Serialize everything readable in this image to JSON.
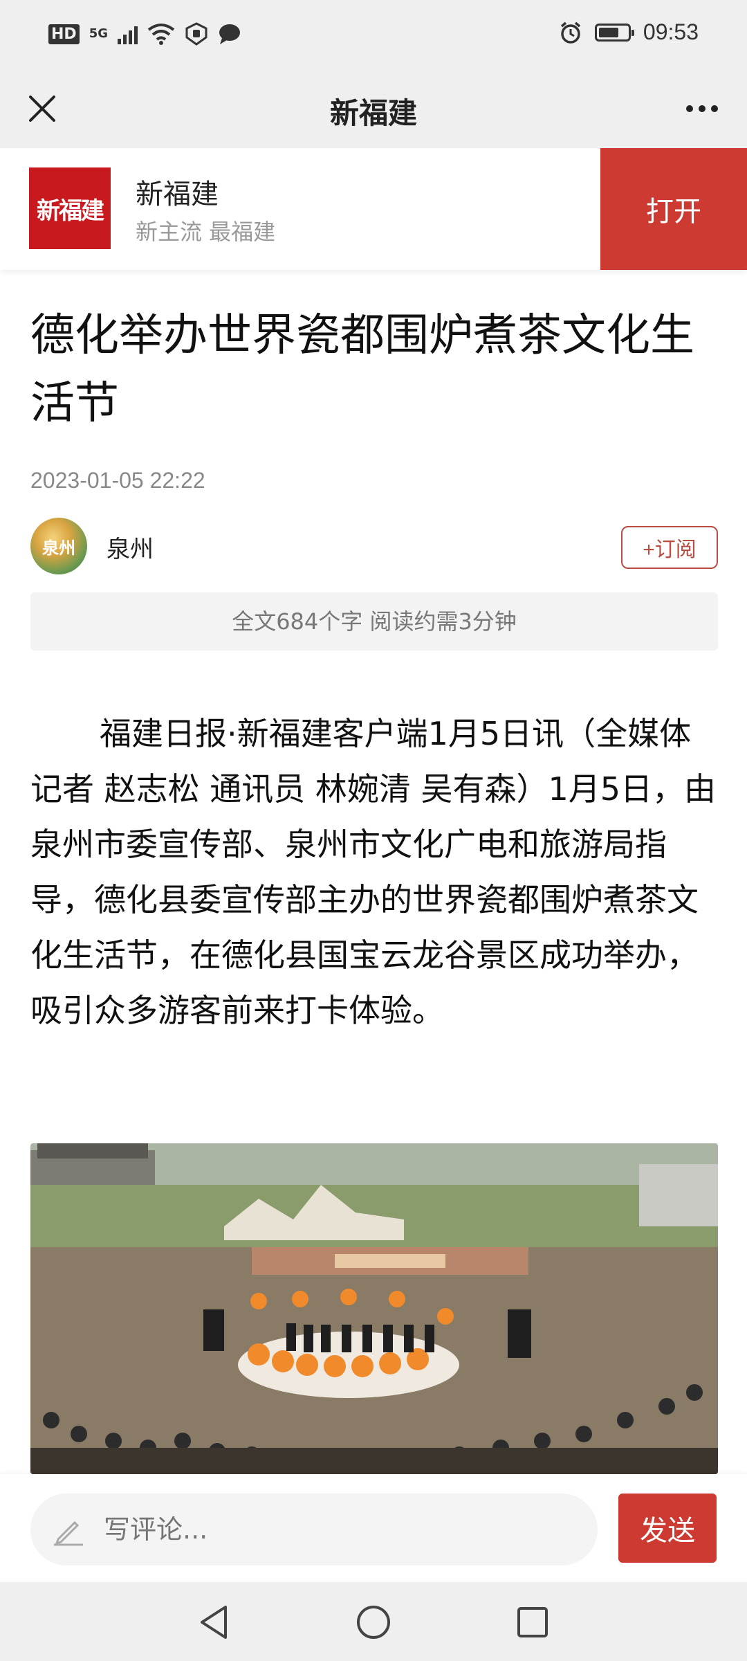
{
  "status_bar": {
    "network_hd": "HD",
    "network_5g": "5G",
    "time": "09:53"
  },
  "nav": {
    "title": "新福建"
  },
  "app_banner": {
    "logo_text": "新福建",
    "name": "新福建",
    "slogan": "新主流 最福建",
    "open_label": "打开"
  },
  "article": {
    "title": "德化举办世界瓷都围炉煮茶文化生活节",
    "date": "2023-01-05 22:22",
    "author": {
      "avatar_text": "泉州",
      "name": "泉州",
      "subscribe_label": "+订阅"
    },
    "read_info": "全文684个字 阅读约需3分钟",
    "body": "福建日报·新福建客户端1月5日讯（全媒体记者 赵志松 通讯员 林婉清 吴有森）1月5日，由泉州市委宣传部、泉州市文化广电和旅游局指导，德化县委宣传部主办的世界瓷都围炉煮茶文化生活节，在德化县国宝云龙谷景区成功举办，吸引众多游客前来打卡体验。"
  },
  "comment": {
    "placeholder": "写评论...",
    "send_label": "发送"
  },
  "colors": {
    "brand_red": "#cd3a32",
    "bar_gray": "#efefef"
  }
}
